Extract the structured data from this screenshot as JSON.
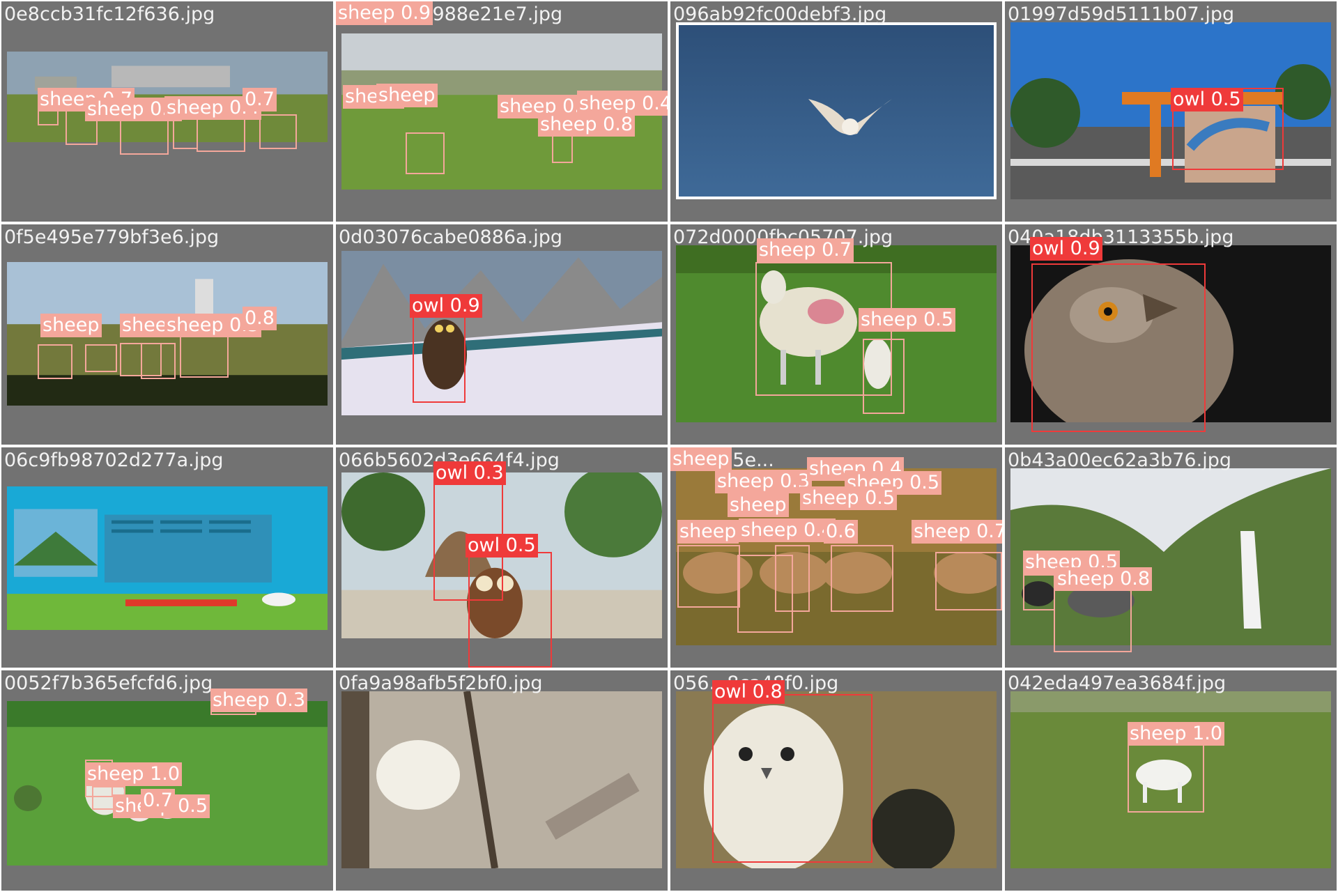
{
  "tiles": [
    {
      "file": "0e8ccb31fc12f636.jpg",
      "scene": "field-wide",
      "labels": [
        {
          "text": "sheep 0.7",
          "cls": "sheep"
        },
        {
          "text": "sheep 0.8",
          "cls": "sheep"
        },
        {
          "text": "sheep 0.4",
          "cls": "sheep"
        },
        {
          "text": "0.7",
          "cls": "sheep"
        }
      ]
    },
    {
      "file": "0e26cb77988e21e7.jpg",
      "scene": "field-sky",
      "labels": [
        {
          "text": "sheep",
          "cls": "sheep"
        },
        {
          "text": "sheep",
          "cls": "sheep"
        },
        {
          "text": "sheep 0.3",
          "cls": "sheep"
        },
        {
          "text": "sheep 0.3",
          "cls": "sheep"
        },
        {
          "text": "sheep 0.4",
          "cls": "sheep"
        },
        {
          "text": "sheep 0.8",
          "cls": "sheep"
        },
        {
          "text": "sheep 0.9",
          "cls": "sheep"
        }
      ]
    },
    {
      "file": "096ab92fc00debf3.jpg",
      "scene": "sky-owl",
      "labels": []
    },
    {
      "file": "01997d59d5111b07.jpg",
      "scene": "road-art",
      "labels": [
        {
          "text": "owl 0.5",
          "cls": "owl"
        }
      ]
    },
    {
      "file": "0f5e495e779bf3e6.jpg",
      "scene": "hill-sky",
      "labels": [
        {
          "text": "sheep",
          "cls": "sheep"
        },
        {
          "text": "sheep",
          "cls": "sheep"
        },
        {
          "text": "sheep 0.3",
          "cls": "sheep"
        },
        {
          "text": "0.8",
          "cls": "sheep"
        }
      ]
    },
    {
      "file": "0d03076cabe0886a.jpg",
      "scene": "snow-game",
      "labels": [
        {
          "text": "owl 0.9",
          "cls": "owl"
        }
      ]
    },
    {
      "file": "072d0000fbc05707.jpg",
      "scene": "grass-sheep",
      "labels": [
        {
          "text": "sheep 0.7",
          "cls": "sheep"
        },
        {
          "text": "sheep 0.5",
          "cls": "sheep"
        }
      ]
    },
    {
      "file": "040a18db3113355b.jpg",
      "scene": "dark-owl",
      "labels": [
        {
          "text": "owl 0.9",
          "cls": "owl"
        }
      ]
    },
    {
      "file": "06c9fb98702d277a.jpg",
      "scene": "poster",
      "labels": []
    },
    {
      "file": "066b5602d3e664f4.jpg",
      "scene": "game-village",
      "labels": [
        {
          "text": "owl 0.3",
          "cls": "owl"
        },
        {
          "text": "owl 0.5",
          "cls": "owl"
        }
      ]
    },
    {
      "file": "084de5e...",
      "scene": "herd-field",
      "labels": [
        {
          "text": "sheep 0.3",
          "cls": "sheep"
        },
        {
          "text": "sheep 0.4",
          "cls": "sheep"
        },
        {
          "text": "sheep 0.5",
          "cls": "sheep"
        },
        {
          "text": "sheep 0.5",
          "cls": "sheep"
        },
        {
          "text": "sheep",
          "cls": "sheep"
        },
        {
          "text": "sheep 0.4",
          "cls": "sheep"
        },
        {
          "text": "sheep",
          "cls": "sheep"
        },
        {
          "text": "0.6",
          "cls": "sheep"
        },
        {
          "text": "sheep 0.7",
          "cls": "sheep"
        },
        {
          "text": "sheep",
          "cls": "sheep"
        }
      ]
    },
    {
      "file": "0b43a00ec62a3b76.jpg",
      "scene": "waterfall",
      "labels": [
        {
          "text": "sheep 0.5",
          "cls": "sheep"
        },
        {
          "text": "sheep 0.8",
          "cls": "sheep"
        }
      ]
    },
    {
      "file": "0052f7b365efcfd6.jpg",
      "scene": "park",
      "labels": [
        {
          "text": "sheep 0.3",
          "cls": "sheep"
        },
        {
          "text": "sheep 1.0",
          "cls": "sheep"
        },
        {
          "text": "sheep 0.5",
          "cls": "sheep"
        },
        {
          "text": "0.7",
          "cls": "sheep"
        }
      ]
    },
    {
      "file": "0fa9a98afb5f2bf0.jpg",
      "scene": "forest-sheep",
      "labels": []
    },
    {
      "file": "056...8ca48f0.jpg",
      "scene": "snowy-owl",
      "labels": [
        {
          "text": "owl 0.8",
          "cls": "owl"
        }
      ]
    },
    {
      "file": "042eda497ea3684f.jpg",
      "scene": "slope-goat",
      "labels": [
        {
          "text": "sheep 1.0",
          "cls": "sheep"
        }
      ]
    }
  ],
  "colors": {
    "sheep": "#f4a79b",
    "owl": "#ef3a3a",
    "tile_bg": "#727272"
  }
}
